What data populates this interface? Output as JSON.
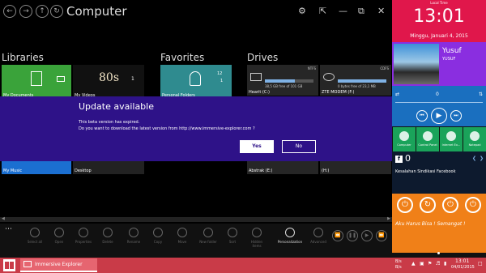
{
  "window": {
    "title": "Computer"
  },
  "sections": {
    "libraries": "Libraries",
    "favorites": "Favorites",
    "drives": "Drives"
  },
  "libraries": [
    {
      "name": "My Documents",
      "color": "#3aa33a"
    },
    {
      "name": "My Videos",
      "color": "#111111",
      "badge": "1",
      "art": "80s"
    },
    {
      "name": "My Music",
      "color": "#1b6fd1"
    },
    {
      "name": "Desktop",
      "color": "#222222"
    }
  ],
  "favorites": [
    {
      "name": "Personal Folders",
      "badge": "12",
      "badge2": "1"
    }
  ],
  "drives": [
    {
      "name": "Hearit (C:)",
      "fs": "NTFS",
      "free": "38,5 GB free of 101 GB",
      "fill": 0.62
    },
    {
      "name": "ZTE MODEM (F:)",
      "fs": "CDFS",
      "free": "0 bytes free of 23,1 MB",
      "fill": 1.0
    },
    {
      "name": "Abstrak (E:)",
      "fs": "",
      "free": "",
      "fill": 0.4
    },
    {
      "name": "(H:)",
      "fs": "",
      "free": "",
      "fill": 0.2
    }
  ],
  "appbar": [
    "Select all",
    "Open",
    "Properties",
    "Delete",
    "Rename",
    "Copy",
    "Move",
    "New folder",
    "Sort",
    "Hidden items",
    "Personalization",
    "Advanced"
  ],
  "dialog": {
    "title": "Update available",
    "line1": "This beta version has expired.",
    "line2": "Do you want to download the latest version from http://www.immersive-explorer.com ?",
    "yes": "Yes",
    "no": "No"
  },
  "sidebar": {
    "local_time_label": "Local Time",
    "time": "13:01",
    "date": "Minggu, Januari 4, 2015",
    "profile_name": "Yusuf",
    "profile_user": "YUSUF",
    "media_counter": "0",
    "quick_tiles": [
      {
        "label": "Computer",
        "color": "#1aa35a"
      },
      {
        "label": "Control Panel",
        "color": "#1aa35a"
      },
      {
        "label": "Internet Ex...",
        "color": "#1aa35a"
      },
      {
        "label": "Notepad",
        "color": "#1aa35a"
      }
    ],
    "fb_count": "0",
    "fb_text": "Kesalahan Sindikasi Facebook",
    "motto": "Aku Harus Bisa ! Semangat !"
  },
  "taskbar": {
    "app_label": "Immersive Explorer",
    "net_up": "B/s",
    "net_down": "B/s",
    "time": "13:01",
    "date": "04/01/2015"
  }
}
